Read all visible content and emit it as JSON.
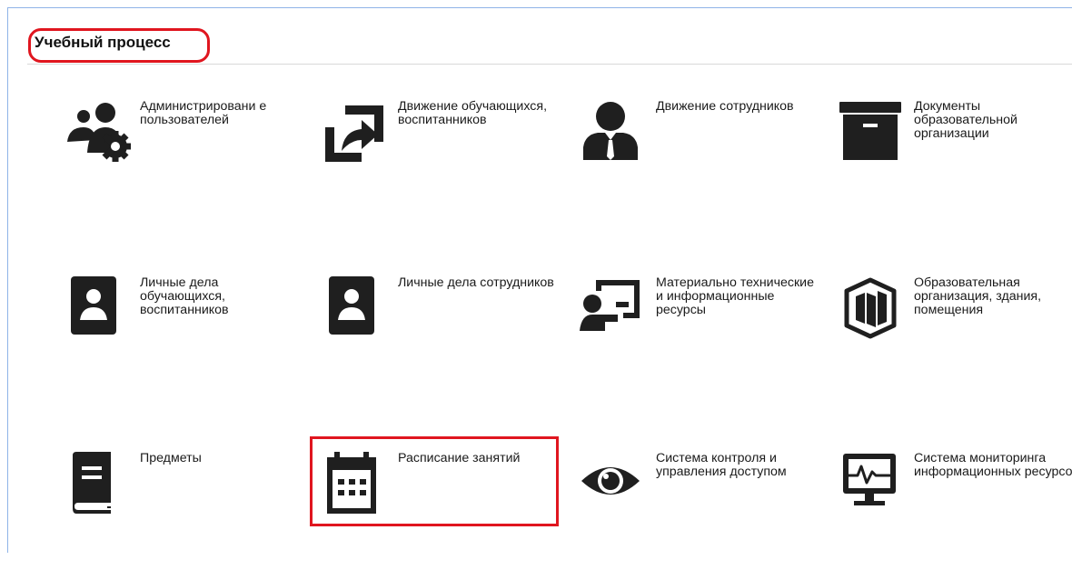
{
  "section": {
    "title": "Учебный процесс"
  },
  "tiles": [
    {
      "label": "Администрировани е пользователей",
      "icon": "users-gear-icon"
    },
    {
      "label": "Движение обучающихся, воспитанников",
      "icon": "share-arrow-icon"
    },
    {
      "label": "Движение сотрудников",
      "icon": "employee-icon"
    },
    {
      "label": "Документы образовательной организации",
      "icon": "archive-box-icon"
    },
    {
      "label": "Личные дела обучающихся, воспитанников",
      "icon": "contact-card-icon"
    },
    {
      "label": "Личные дела сотрудников",
      "icon": "contact-card-icon"
    },
    {
      "label": "Материально технические и информационные ресурсы",
      "icon": "presentation-icon"
    },
    {
      "label": "Образовательная организация, здания, помещения",
      "icon": "building-3d-icon"
    },
    {
      "label": "Предметы",
      "icon": "book-icon"
    },
    {
      "label": "Расписание занятий",
      "icon": "calendar-icon"
    },
    {
      "label": "Система контроля и управления доступом",
      "icon": "eye-icon"
    },
    {
      "label": "Система мониторинга информационных ресурсов",
      "icon": "monitor-pulse-icon"
    }
  ],
  "colors": {
    "highlight": "#e0161f",
    "icon": "#1f1f1f",
    "frame": "#8fb4e8"
  }
}
